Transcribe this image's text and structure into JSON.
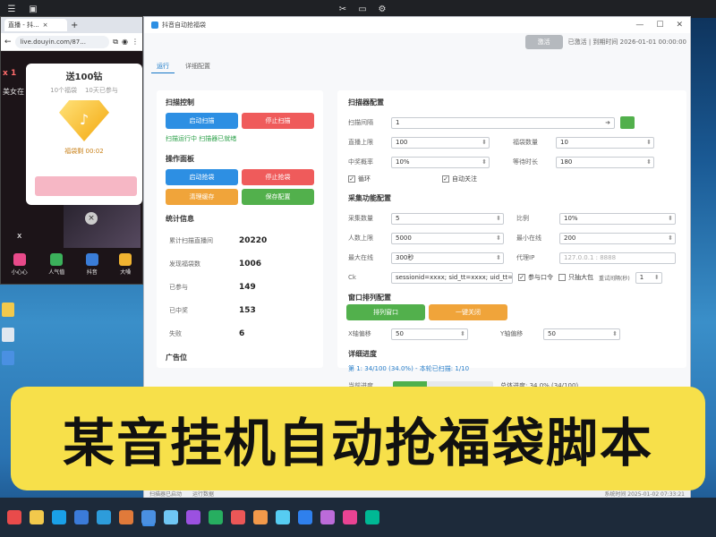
{
  "browser": {
    "tab_title": "直播 - 抖...",
    "url": "live.douyin.com/87...",
    "popup": {
      "title": "送100钻",
      "subtitle_1": "10个福袋",
      "subtitle_2": "10天已参与",
      "tag": "福袋剩 00:02"
    },
    "left_texts": [
      "x 1",
      "美女在"
    ],
    "close_x": "x",
    "bottom_items": [
      {
        "label": "小心心",
        "color": "#e84a8a"
      },
      {
        "label": "人气值",
        "color": "#3bb15b"
      },
      {
        "label": "抖音",
        "color": "#3a7dd8"
      },
      {
        "label": "大嗓",
        "color": "#f0b331"
      }
    ]
  },
  "tool": {
    "title": "抖音自动抢福袋",
    "license_button": "激活",
    "license_text": "已激活 | 到期时间 2026-01-01 00:00:00",
    "tabs": [
      "运行",
      "详细配置"
    ],
    "left": {
      "scan_title": "扫描控制",
      "scan_start": "启动扫描",
      "scan_stop": "停止扫描",
      "scan_status": "扫描运行中 扫描器已就绪",
      "op_title": "操作面板",
      "op_btn_1": "启动抢袋",
      "op_btn_2": "停止抢袋",
      "op_btn_3": "清理缓存",
      "op_btn_4": "保存配置",
      "stats_title": "统计信息",
      "stats": [
        {
          "label": "累计扫描直播间",
          "value": "20220"
        },
        {
          "label": "发现福袋数",
          "value": "1006"
        },
        {
          "label": "已参与",
          "value": "149"
        },
        {
          "label": "已中奖",
          "value": "153"
        },
        {
          "label": "失败",
          "value": "6"
        }
      ],
      "ad_title": "广告位"
    },
    "right": {
      "scan_cfg_title": "扫描器配置",
      "interval_label": "扫描间隔",
      "interval_value": "1",
      "r1_label_a": "直播上限",
      "r1_value_a": "100",
      "r1_label_b": "福袋数量",
      "r1_value_b": "10",
      "r2_label_a": "中奖概率",
      "r2_value_a": "10%",
      "r2_label_b": "等待时长",
      "r2_value_b": "180",
      "check_loop": "循环",
      "check_auto": "自动关注",
      "collect_title": "采集功能配置",
      "c1_label_a": "采集数量",
      "c1_value_a": "5",
      "c1_label_b": "比例",
      "c1_value_b": "10%",
      "c2_label_a": "人数上限",
      "c2_value_a": "5000",
      "c2_label_b": "最小在线",
      "c2_value_b": "200",
      "c3_label_a": "最大在线",
      "c3_value_a": "300秒",
      "c3_label_b": "代理IP",
      "c3_value_b": "127.0.0.1 : 8888",
      "ck_label": "Ck",
      "ck_value": "sessionid=xxxx; sid_tt=xxxx; uid_tt=xxxx",
      "ck_check": "参与口令",
      "ck_check2": "只抽大包",
      "ck_interval_label": "重试间隔(秒)",
      "ck_interval_value": "1",
      "tail_title": "窗口排列配置",
      "tail_btn_1": "排列窗口",
      "tail_btn_2": "一键关闭",
      "x_label": "X轴偏移",
      "x_value": "50",
      "y_label": "Y轴偏移",
      "y_value": "50",
      "progress_title": "详细进度",
      "progress_line": "第 1: 34/100 (34.0%) - 本轮已扫描: 1/10",
      "progress_label": "当前进度",
      "progress_fraction": 0.34,
      "progress_right": "总体进度: 34.0% (34/100)"
    },
    "statusbar": {
      "left": "扫描器已启动",
      "mid": "运行数据",
      "right": "系统时间 2025-01-02 07:33:21"
    }
  },
  "banner": {
    "text": "某音挂机自动抢福袋脚本"
  },
  "taskbar": {
    "icon_colors": [
      "#e94b4b",
      "#f2c94c",
      "#1aa0e8",
      "#3b7bd9",
      "#2d9cdb",
      "#e07a3a",
      "#4a90e2",
      "#6fc6f4",
      "#9b51e0",
      "#27ae60",
      "#eb5757",
      "#f2994a",
      "#56ccf2",
      "#2f80ed",
      "#bb6bd9",
      "#e84393",
      "#00b894"
    ]
  },
  "colors": {
    "banner": "#f7e04a",
    "primary_blue": "#2d8fe3",
    "danger_red": "#ef5b5b",
    "warn_orange": "#f0a43a",
    "success_green": "#52b04c"
  }
}
